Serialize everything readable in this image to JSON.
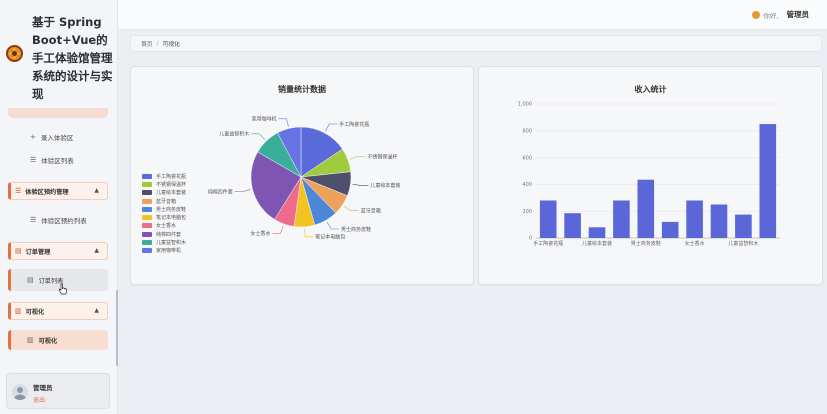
{
  "brand": {
    "title": "基于 Spring Boot+Vue的手工体验馆管理系统的设计与实现",
    "logo_icon": "sunflower-logo-icon"
  },
  "sidebar": {
    "items": [
      {
        "label": "录入体验区",
        "icon": "plus-icon"
      },
      {
        "label": "体验区列表",
        "icon": "list-icon"
      }
    ],
    "groups": [
      {
        "label": "体验区预约管理",
        "icon": "list-icon",
        "chevron": "chevron-up-icon",
        "children": [
          {
            "label": "体验区预约列表",
            "icon": "list-icon"
          }
        ]
      },
      {
        "label": "订单管理",
        "icon": "document-icon",
        "chevron": "chevron-up-icon",
        "children": [
          {
            "label": "订单列表",
            "icon": "document-icon"
          }
        ]
      },
      {
        "label": "可视化",
        "icon": "chart-icon",
        "chevron": "chevron-up-icon",
        "children": [
          {
            "label": "可视化",
            "icon": "chart-icon"
          }
        ]
      }
    ],
    "user": {
      "name": "管理员",
      "logout": "退出"
    }
  },
  "header": {
    "greeting": "你好,",
    "username": "管理员"
  },
  "breadcrumb": {
    "home": "首页",
    "separator": "/",
    "current": "可视化"
  },
  "colors": {
    "accent": "#e0723f",
    "bar": "#5b67d8"
  },
  "chart_data": [
    {
      "type": "pie",
      "title": "销量统计数据",
      "legend_position": "left",
      "categories": [
        "手工陶瓷花瓶",
        "不锈钢保温杯",
        "儿童绘本套装",
        "蓝牙音箱",
        "男士商务皮鞋",
        "笔记本电脑包",
        "女士香水",
        "纯棉四件套",
        "儿童益智积木",
        "家用咖啡机"
      ],
      "values": [
        14,
        7,
        7,
        6,
        7,
        6,
        6,
        22,
        8,
        7
      ],
      "colors": [
        "#5b6ad9",
        "#9fcb3c",
        "#4d4f6b",
        "#eea15a",
        "#4d88d8",
        "#f3c323",
        "#ef6b8c",
        "#7e55b3",
        "#3aae9b",
        "#6772e4"
      ]
    },
    {
      "type": "bar",
      "title": "收入统计",
      "categories": [
        "手工陶瓷花瓶",
        "不锈钢保温杯",
        "儿童绘本套装",
        "蓝牙音箱",
        "男士商务皮鞋",
        "笔记本电脑包",
        "女士香水",
        "纯棉四件套",
        "儿童益智积木",
        "家用咖啡机"
      ],
      "tick_labels": [
        "手工陶瓷花瓶",
        "儿童绘本套装",
        "男士商务皮鞋",
        "女士香水",
        "儿童益智积木"
      ],
      "values": [
        280,
        185,
        80,
        280,
        435,
        120,
        280,
        250,
        175,
        850
      ],
      "yticks": [
        "0",
        "200",
        "400",
        "600",
        "800",
        "1,000"
      ],
      "ylim": [
        0,
        1000
      ],
      "grid": true
    }
  ]
}
